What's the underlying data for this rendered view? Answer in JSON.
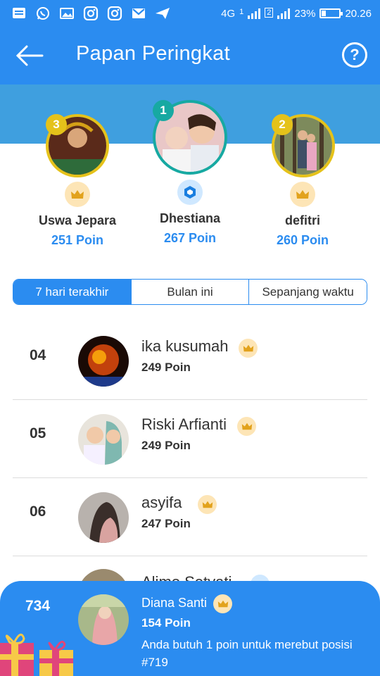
{
  "status_bar": {
    "network": "4G",
    "sim1_label": "1",
    "sim2_label": "2",
    "battery": "23%",
    "battery_level": 0.23,
    "time": "20.26",
    "icons": [
      "message-icon",
      "whatsapp-icon",
      "gallery-icon",
      "instagram-icon",
      "instagram-icon",
      "gmail-icon",
      "send-icon"
    ]
  },
  "header": {
    "title": "Papan Peringkat",
    "back_icon": "arrow-left-icon",
    "help_label": "?"
  },
  "podium": [
    {
      "rank": "3",
      "name": "Uswa Jepara",
      "points": "251 Poin",
      "badge": "crown-icon"
    },
    {
      "rank": "1",
      "name": "Dhestiana",
      "points": "267 Poin",
      "badge": "hexagon-badge-icon"
    },
    {
      "rank": "2",
      "name": "defitri",
      "points": "260 Poin",
      "badge": "crown-icon"
    }
  ],
  "tabs": [
    {
      "label": "7 hari terakhir",
      "active": true
    },
    {
      "label": "Bulan ini",
      "active": false
    },
    {
      "label": "Sepanjang waktu",
      "active": false
    }
  ],
  "rows": [
    {
      "rank": "04",
      "name": "ika kusumah",
      "points": "249 Poin",
      "badge": "crown-icon"
    },
    {
      "rank": "05",
      "name": "Riski Arfianti",
      "points": "249 Poin",
      "badge": "crown-icon"
    },
    {
      "rank": "06",
      "name": "asyifa",
      "points": "247 Poin",
      "badge": "crown-icon"
    }
  ],
  "peek_row": {
    "name": "Alimo Setyati"
  },
  "me": {
    "rank": "734",
    "name": "Diana Santi",
    "points": "154 Poin",
    "message": "Anda butuh 1 poin untuk merebut posisi #719",
    "badge": "crown-icon"
  },
  "colors": {
    "primary": "#2b8cf0",
    "band": "#3f9fdf",
    "gold": "#e5c21a",
    "teal": "#17a9a2",
    "crown_bg": "#fde5b6",
    "crown": "#e2a21c"
  }
}
